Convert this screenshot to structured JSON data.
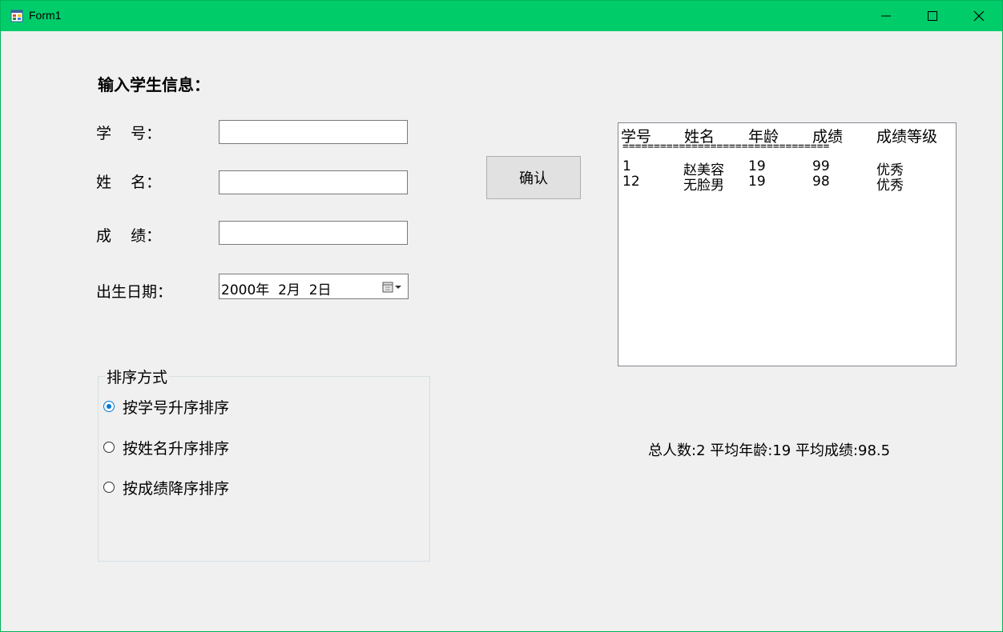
{
  "window": {
    "title": "Form1"
  },
  "form": {
    "heading": "输入学生信息：",
    "labels": {
      "id": "学    号：",
      "name": "姓    名：",
      "score": "成    绩：",
      "birth": "出生日期："
    },
    "inputs": {
      "id": "",
      "name": "",
      "score": ""
    },
    "birth_value": "2000年  2月  2日",
    "confirm_label": "确认"
  },
  "list": {
    "headers": [
      "学号",
      "姓名",
      "年龄",
      "成绩",
      "成绩等级"
    ],
    "separator": "=================================",
    "rows": [
      [
        "1",
        "赵美容",
        "19",
        "99",
        "优秀"
      ],
      [
        "12",
        "无脸男",
        "19",
        "98",
        "优秀"
      ]
    ]
  },
  "sort": {
    "caption": "排序方式",
    "options": [
      "按学号升序排序",
      "按姓名升序排序",
      "按成绩降序排序"
    ],
    "selected": "按学号升序排序"
  },
  "summary": "总人数:2 平均年龄:19 平均成绩:98.5"
}
